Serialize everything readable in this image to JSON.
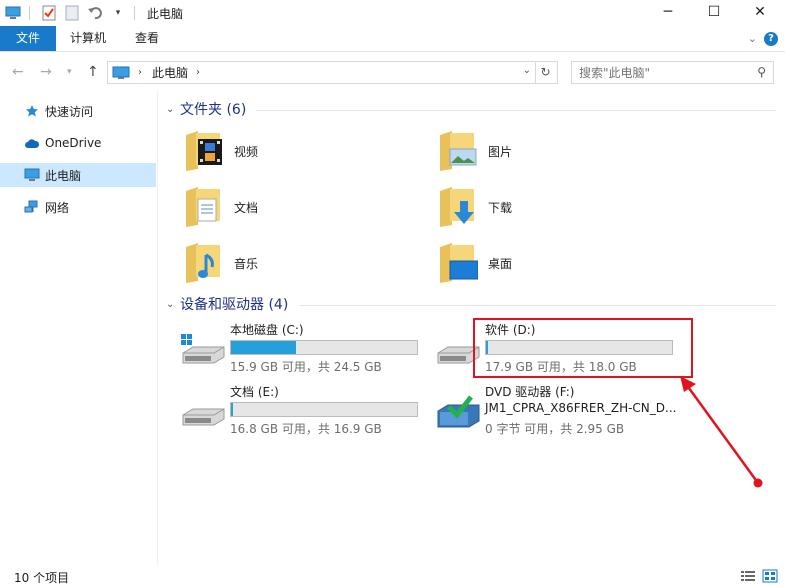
{
  "titlebar": {
    "title": "此电脑",
    "minimize_symbol": "─",
    "maximize_symbol": "☐",
    "close_symbol": "✕"
  },
  "ribbon": {
    "tabs": [
      {
        "label": "文件",
        "active": true
      },
      {
        "label": "计算机"
      },
      {
        "label": "查看"
      }
    ],
    "help": "?"
  },
  "address": {
    "crumb": "此电脑",
    "search_placeholder": "搜索\"此电脑\""
  },
  "sidebar": {
    "items": [
      {
        "label": "快速访问",
        "icon": "star-icon"
      },
      {
        "label": "OneDrive",
        "icon": "cloud-icon"
      },
      {
        "label": "此电脑",
        "icon": "computer-icon",
        "selected": true
      },
      {
        "label": "网络",
        "icon": "network-icon"
      }
    ]
  },
  "folders_section": {
    "header": "文件夹 (6)",
    "items": [
      {
        "label": "视频",
        "icon": "video-folder-icon"
      },
      {
        "label": "图片",
        "icon": "pictures-folder-icon"
      },
      {
        "label": "文档",
        "icon": "documents-folder-icon"
      },
      {
        "label": "下载",
        "icon": "downloads-folder-icon"
      },
      {
        "label": "音乐",
        "icon": "music-folder-icon"
      },
      {
        "label": "桌面",
        "icon": "desktop-folder-icon"
      }
    ]
  },
  "drives_section": {
    "header": "设备和驱动器 (4)",
    "items": [
      {
        "label": "本地磁盘 (C:)",
        "info": "15.9 GB 可用，共 24.5 GB",
        "used_fraction": 0.35
      },
      {
        "label": "软件 (D:)",
        "info": "17.9 GB 可用，共 18.0 GB",
        "used_fraction": 0.01
      },
      {
        "label": "文档 (E:)",
        "info": "16.8 GB 可用，共 16.9 GB",
        "used_fraction": 0.01
      },
      {
        "label": "DVD 驱动器 (F:)",
        "sublabel": "JM1_CPRA_X86FRER_ZH-CN_D...",
        "info": "0 字节 可用，共 2.95 GB"
      }
    ]
  },
  "statusbar": {
    "count": "10 个项目"
  },
  "colors": {
    "accent": "#1979ca",
    "drive_fill": "#26a0da",
    "highlight": "#e0141e",
    "header_text": "#1e3287"
  }
}
